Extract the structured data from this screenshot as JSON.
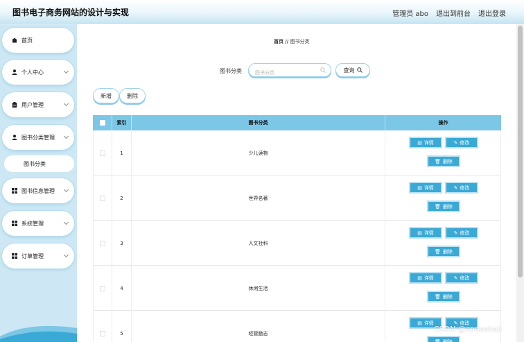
{
  "header": {
    "title": "图书电子商务网站的设计与实现",
    "admin_label": "管理员 abo",
    "back_label": "退出到前台",
    "logout_label": "退出登录"
  },
  "sidebar": {
    "items": [
      {
        "label": "首页",
        "icon": "home-icon"
      },
      {
        "label": "个人中心",
        "icon": "user-icon"
      },
      {
        "label": "用户管理",
        "icon": "clipboard-icon"
      },
      {
        "label": "图书分类管理",
        "icon": "user-icon"
      },
      {
        "label": "图书信息管理",
        "icon": "grid-icon"
      },
      {
        "label": "系统管理",
        "icon": "grid-icon"
      },
      {
        "label": "订单管理",
        "icon": "grid-icon"
      }
    ],
    "sub_item": "图书分类"
  },
  "breadcrumb": {
    "home": "首页",
    "sep": "//",
    "current": "图书分类"
  },
  "search": {
    "label": "图书分类",
    "placeholder": "图书分类",
    "button": "查询"
  },
  "toolbar": {
    "add": "新增",
    "delete": "删除"
  },
  "table": {
    "headers": {
      "index": "索引",
      "category": "图书分类",
      "actions": "操作"
    },
    "rows": [
      {
        "index": "1",
        "category": "少儿读物"
      },
      {
        "index": "2",
        "category": "世界名著"
      },
      {
        "index": "3",
        "category": "人文社科"
      },
      {
        "index": "4",
        "category": "休闲生活"
      },
      {
        "index": "5",
        "category": "经管励志"
      }
    ],
    "actions": {
      "detail": "详情",
      "edit": "修改",
      "delete": "删除"
    }
  },
  "watermark": "CSDN @codesheji",
  "colors": {
    "accent": "#3aa9d6",
    "header_bg": "#7cc6e6",
    "sidebar_bg": "#cde8f4"
  }
}
